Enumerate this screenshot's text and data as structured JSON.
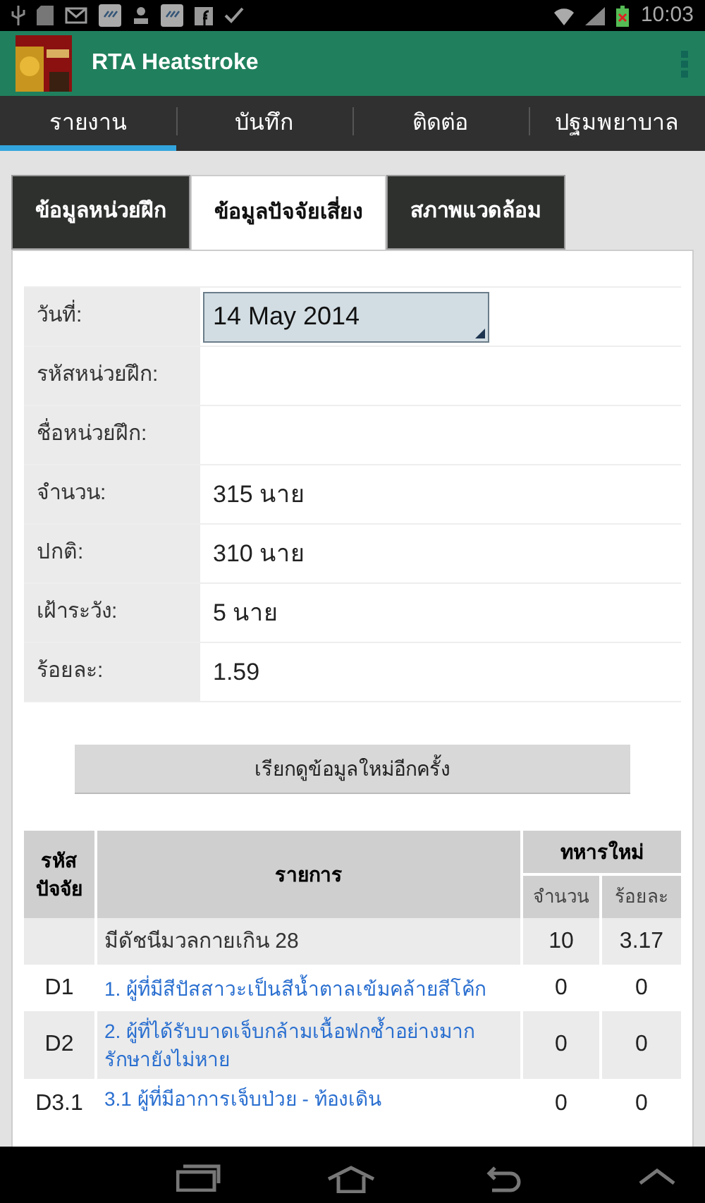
{
  "status_bar": {
    "time": "10:03"
  },
  "app_bar": {
    "title": "RTA Heatstroke"
  },
  "tabs": [
    {
      "label": "รายงาน",
      "selected": true
    },
    {
      "label": "บันทึก",
      "selected": false
    },
    {
      "label": "ติดต่อ",
      "selected": false
    },
    {
      "label": "ปฐมพยาบาล",
      "selected": false
    }
  ],
  "sub_tabs": [
    {
      "label": "ข้อมูลหน่วยฝึก",
      "selected": false
    },
    {
      "label": "ข้อมูลปัจจัยเสี่ยง",
      "selected": true
    },
    {
      "label": "สภาพแวดล้อม",
      "selected": false
    }
  ],
  "form": [
    {
      "label": "วันที่:",
      "kind": "date",
      "value": "14 May 2014"
    },
    {
      "label": "รหัสหน่วยฝึก:",
      "kind": "text"
    },
    {
      "label": "ชื่อหน่วยฝึก:",
      "kind": "text"
    },
    {
      "label": "จำนวน:",
      "kind": "text",
      "value": "315 นาย"
    },
    {
      "label": "ปกติ:",
      "kind": "text",
      "value": "310 นาย"
    },
    {
      "label": "เฝ้าระวัง:",
      "kind": "text",
      "value": "5 นาย"
    },
    {
      "label": "ร้อยละ:",
      "kind": "text",
      "value": "1.59"
    }
  ],
  "reload_button": "เรียกดูข้อมูลใหม่อีกครั้ง",
  "table": {
    "columns": {
      "code": "รหัส ปัจจัย",
      "item": "รายการ",
      "group": "ทหารใหม่",
      "count": "จำนวน",
      "percent": "ร้อยละ"
    },
    "rows": [
      {
        "kind": "summary",
        "item": "มีดัชนีมวลกายเกิน 28",
        "count": "10",
        "percent": "3.17"
      },
      {
        "kind": "link",
        "code": "D1",
        "item": "1. ผู้ที่มีสีปัสสาวะเป็นสีน้ำตาลเข้มคล้ายสีโค้ก",
        "count": "0",
        "percent": "0"
      },
      {
        "kind": "link",
        "code": "D2",
        "item": "2. ผู้ที่ได้รับบาดเจ็บกล้ามเนื้อฟกช้ำอย่างมากรักษายังไม่หาย",
        "count": "0",
        "percent": "0"
      },
      {
        "kind": "link",
        "code": "D3.1",
        "item": "3.1 ผู้ที่มีอาการเจ็บป่วย - ท้องเดิน",
        "count": "0",
        "percent": "0"
      }
    ]
  }
}
